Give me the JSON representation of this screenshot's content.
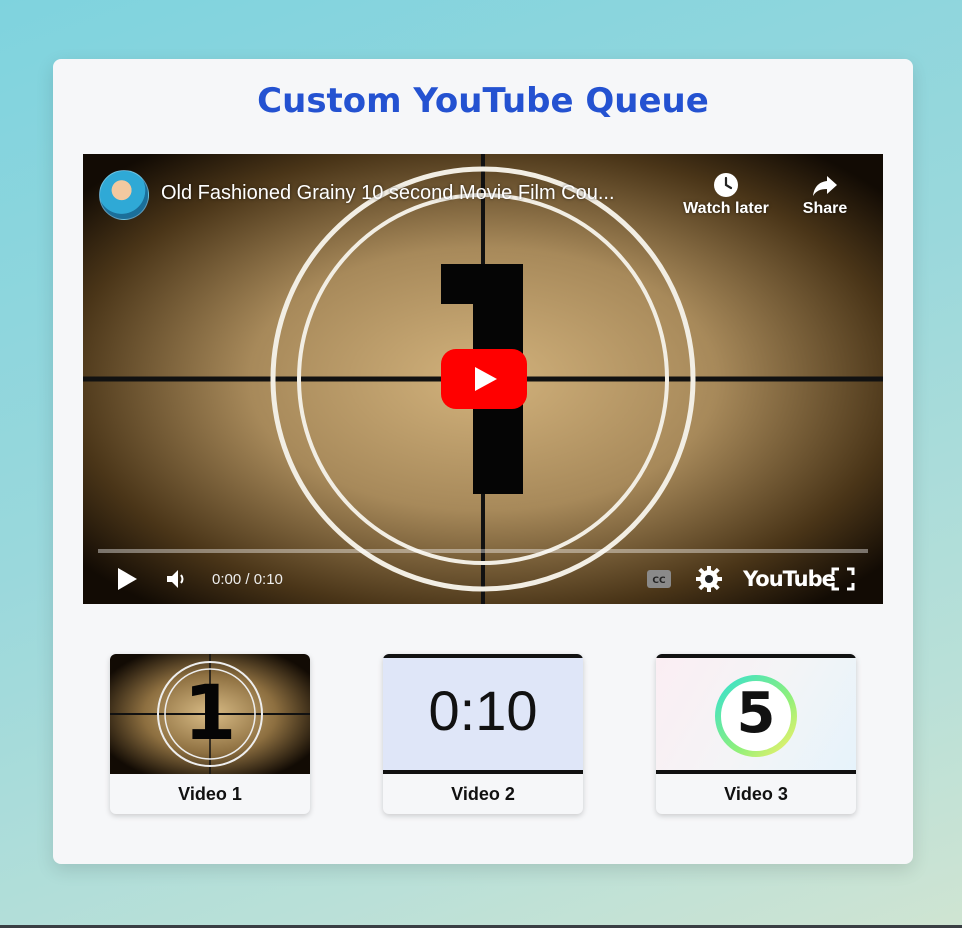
{
  "page": {
    "title": "Custom YouTube Queue"
  },
  "player": {
    "video_title": "Old Fashioned Grainy 10 second Movie Film Cou...",
    "watch_later_label": "Watch later",
    "share_label": "Share",
    "time_display": "0:00 / 0:10",
    "brand_label": "YouTube",
    "countdown_digit": "1",
    "progress": 0.0
  },
  "queue": [
    {
      "label": "Video 1",
      "thumb_text": "1"
    },
    {
      "label": "Video 2",
      "thumb_text": "0:10"
    },
    {
      "label": "Video 3",
      "thumb_text": "5"
    }
  ],
  "colors": {
    "title": "#2452d1",
    "play_button": "#ff0000",
    "card_bg": "#f6f7f9"
  },
  "icons": [
    "clock-icon",
    "share-arrow-icon",
    "play-icon",
    "volume-icon",
    "captions-icon",
    "gear-icon",
    "fullscreen-icon"
  ]
}
